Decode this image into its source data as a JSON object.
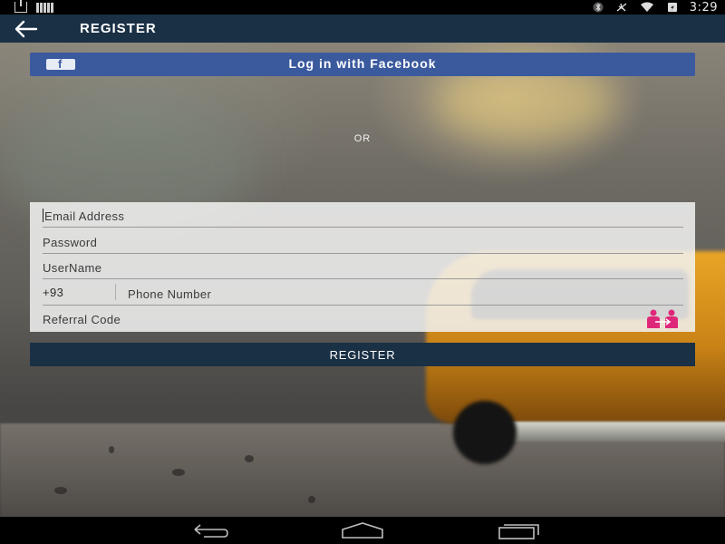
{
  "status_bar": {
    "time": "3:29",
    "icons": [
      "download-icon",
      "barcode-icon",
      "bluetooth-icon",
      "airplane-mode-icon",
      "wifi-icon",
      "battery-icon"
    ]
  },
  "app_bar": {
    "title": "REGISTER",
    "back_icon": "arrow-left-icon"
  },
  "facebook": {
    "label": "Log in with Facebook",
    "icon": "facebook-icon",
    "glyph": "f",
    "color": "#3b5a9e"
  },
  "or_text": "OR",
  "form": {
    "email": {
      "placeholder": "Email Address",
      "value": ""
    },
    "password": {
      "placeholder": "Password",
      "value": ""
    },
    "username": {
      "placeholder": "UserName",
      "value": ""
    },
    "phone": {
      "dial_code": "+93",
      "placeholder": "Phone Number",
      "value": ""
    },
    "referral": {
      "placeholder": "Referral Code",
      "value": "",
      "icon": "referral-people-icon",
      "icon_color": "#e0287a"
    }
  },
  "register_button": {
    "label": "REGISTER",
    "color": "#1a3045"
  },
  "nav_bar": {
    "icons": [
      "back-nav-icon",
      "home-nav-icon",
      "recents-nav-icon"
    ]
  },
  "colors": {
    "app_bar": "#1a3045",
    "facebook": "#3b5a9e",
    "accent_pink": "#e0287a"
  }
}
